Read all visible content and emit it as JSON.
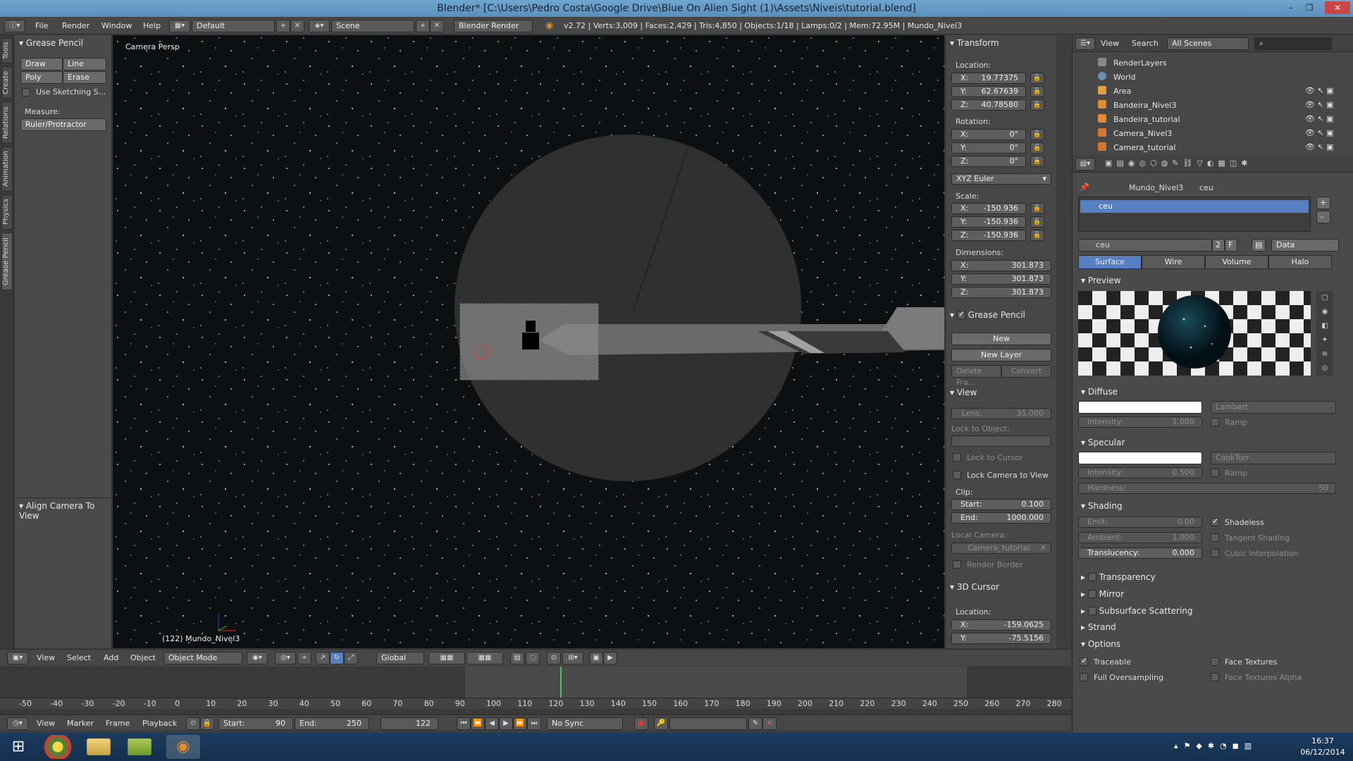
{
  "window": {
    "title": "Blender* [C:\\Users\\Pedro Costa\\Google Drive\\Blue On Alien Sight (1)\\Assets\\Niveis\\tutorial.blend]"
  },
  "menubar": {
    "items": [
      "File",
      "Render",
      "Window",
      "Help"
    ],
    "layout": "Default",
    "scene": "Scene",
    "engine": "Blender Render",
    "stats": "v2.72 | Verts:3,009 | Faces:2,429 | Tris:4,850 | Objects:1/18 | Lamps:0/2 | Mem:72.95M | Mundo_Nivel3"
  },
  "left_tabs": [
    "Tools",
    "Create",
    "Relations",
    "Animation",
    "Physics",
    "Grease Pencil"
  ],
  "tool_shelf": {
    "panel": "Grease Pencil",
    "draw": "Draw",
    "line": "Line",
    "poly": "Poly",
    "erase": "Erase",
    "use_sketching": "Use Sketching S...",
    "measure_label": "Measure:",
    "ruler": "Ruler/Protractor",
    "align_panel": "Align Camera To View"
  },
  "viewport": {
    "label": "Camera Persp",
    "object": "(122) Mundo_Nivel3"
  },
  "npanel": {
    "transform": "Transform",
    "location_label": "Location:",
    "location": {
      "x": "19.77375",
      "y": "62.67639",
      "z": "40.78580"
    },
    "rotation_label": "Rotation:",
    "rotation": {
      "x": "0°",
      "y": "0°",
      "z": "0°"
    },
    "rotation_mode": "XYZ Euler",
    "scale_label": "Scale:",
    "scale": {
      "x": "-150.936",
      "y": "-150.936",
      "z": "-150.936"
    },
    "dimensions_label": "Dimensions:",
    "dimensions": {
      "x": "301.873",
      "y": "301.873",
      "z": "301.873"
    },
    "grease_pencil": "Grease Pencil",
    "new": "New",
    "new_layer": "New Layer",
    "delete_frame": "Delete Fra...",
    "convert": "Convert",
    "view": "View",
    "lens_label": "Lens:",
    "lens": "35.000",
    "lock_to_object": "Lock to Object:",
    "lock_to_cursor": "Lock to Cursor",
    "lock_camera_to_view": "Lock Camera to View",
    "clip_label": "Clip:",
    "clip_start_label": "Start:",
    "clip_start": "0.100",
    "clip_end_label": "End:",
    "clip_end": "1000.000",
    "local_camera_label": "Local Camera:",
    "local_camera": "Camera_tutorial",
    "render_border": "Render Border",
    "cursor": "3D Cursor",
    "cursor_location_label": "Location:",
    "cursor_x": "-159.0625",
    "cursor_y": "-75.5156"
  },
  "outliner": {
    "view": "View",
    "search": "Search",
    "filter": "All Scenes",
    "rows": [
      {
        "name": "RenderLayers"
      },
      {
        "name": "World"
      },
      {
        "name": "Area"
      },
      {
        "name": "Bandeira_Nivel3"
      },
      {
        "name": "Bandeira_tutorial"
      },
      {
        "name": "Camera_Nivel3"
      },
      {
        "name": "Camera_tutorial"
      }
    ]
  },
  "properties": {
    "breadcrumb_object": "Mundo_Nivel3",
    "breadcrumb_material": "ceu",
    "material_slot": "ceu",
    "material_name": "ceu",
    "users": "2",
    "fake": "F",
    "link": "Data",
    "tabs": [
      "Surface",
      "Wire",
      "Volume",
      "Halo"
    ],
    "preview": "Preview",
    "diffuse": "Diffuse",
    "diffuse_shader": "Lambert",
    "diffuse_intensity_label": "Intensity:",
    "diffuse_intensity": "1.000",
    "ramp": "Ramp",
    "specular": "Specular",
    "specular_shader": "CookTorr",
    "specular_intensity_label": "Intensity:",
    "specular_intensity": "0.500",
    "hardness_label": "Hardness:",
    "hardness": "50",
    "shading": "Shading",
    "emit_label": "Emit:",
    "emit": "0.00",
    "shadeless": "Shadeless",
    "ambient_label": "Ambient:",
    "ambient": "1.000",
    "tangent_shading": "Tangent Shading",
    "translucency_label": "Translucency:",
    "translucency": "0.000",
    "cubic": "Cubic Interpolation",
    "transparency": "Transparency",
    "mirror": "Mirror",
    "sss": "Subsurface Scattering",
    "strand": "Strand",
    "options": "Options",
    "traceable": "Traceable",
    "face_textures": "Face Textures",
    "full_oversampling": "Full Oversampling",
    "face_textures_alpha": "Face Textures Alpha"
  },
  "viewport_header": {
    "items": [
      "View",
      "Select",
      "Add",
      "Object"
    ],
    "mode": "Object Mode",
    "orientation": "Global"
  },
  "timeline": {
    "ticks": [
      "-50",
      "-40",
      "-30",
      "-20",
      "-10",
      "0",
      "10",
      "20",
      "30",
      "40",
      "50",
      "60",
      "70",
      "80",
      "90",
      "100",
      "110",
      "120",
      "130",
      "140",
      "150",
      "160",
      "170",
      "180",
      "190",
      "200",
      "210",
      "220",
      "230",
      "240",
      "250",
      "260",
      "270",
      "280"
    ],
    "current_frame_marker": 122,
    "items": [
      "View",
      "Marker",
      "Frame",
      "Playback"
    ],
    "start_label": "Start:",
    "start": "90",
    "end_label": "End:",
    "end": "250",
    "current": "122",
    "sync": "No Sync"
  },
  "taskbar": {
    "time": "16:37",
    "date": "06/12/2014"
  }
}
